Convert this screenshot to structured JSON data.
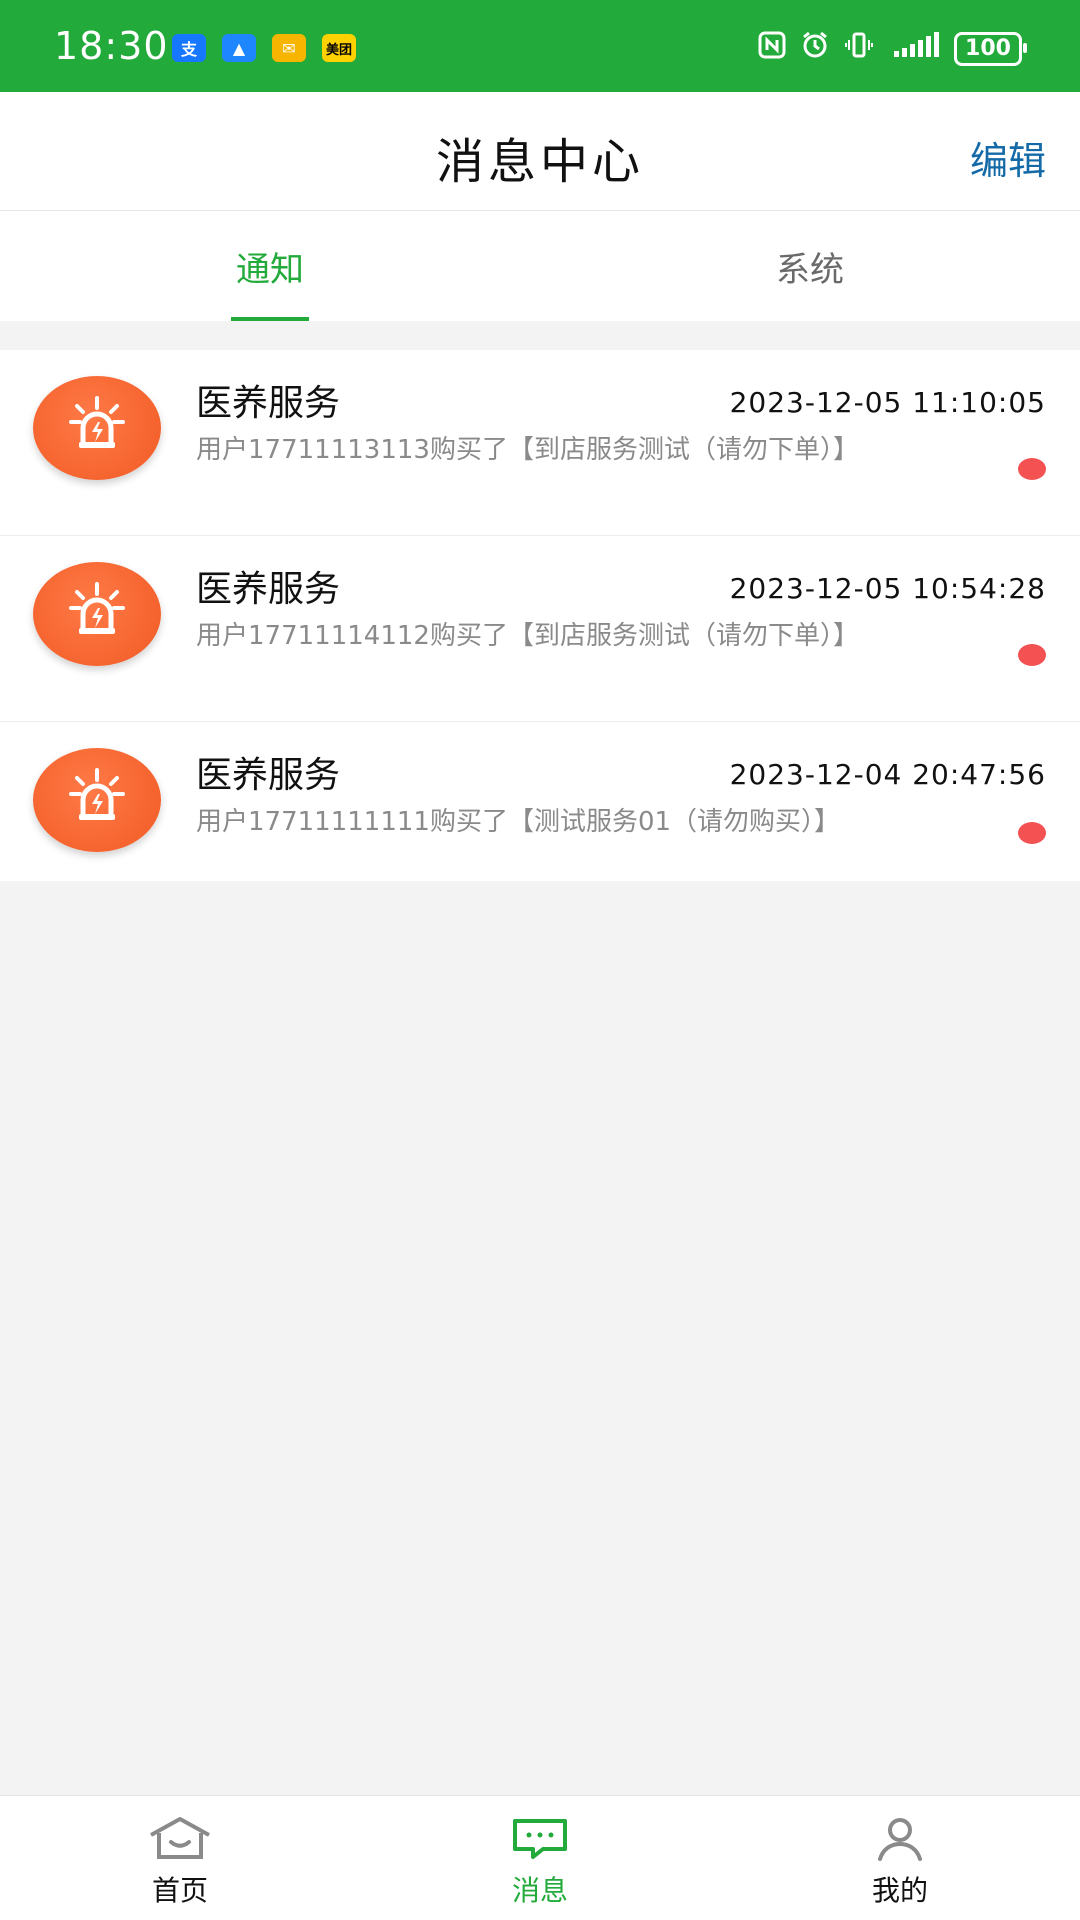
{
  "status_bar": {
    "time": "18:30",
    "apps": [
      {
        "label": "支",
        "name": "alipay-icon",
        "bg": "#1677ff",
        "fg": "#ffffff"
      },
      {
        "label": "▲",
        "name": "nav-app-icon",
        "bg": "#1e86ff",
        "fg": "#ffffff"
      },
      {
        "label": "✉",
        "name": "mail-icon",
        "bg": "#f7b500",
        "fg": "#ffffff"
      },
      {
        "label": "美团",
        "name": "meituan-icon",
        "bg": "#ffd100",
        "fg": "#000000"
      }
    ],
    "battery": "100"
  },
  "header": {
    "title": "消息中心",
    "edit": "编辑"
  },
  "tabs": [
    {
      "label": "通知",
      "active": true
    },
    {
      "label": "系统",
      "active": false
    }
  ],
  "messages": [
    {
      "title": "医养服务",
      "time": "2023-12-05 11:10:05",
      "text": "用户17711113113购买了【到店服务测试（请勿下单）】",
      "unread": true
    },
    {
      "title": "医养服务",
      "time": "2023-12-05 10:54:28",
      "text": "用户17711114112购买了【到店服务测试（请勿下单）】",
      "unread": true
    },
    {
      "title": "医养服务",
      "time": "2023-12-04 20:47:56",
      "text": "用户17711111111购买了【测试服务01（请勿购买）】",
      "unread": true
    }
  ],
  "bottom_nav": [
    {
      "label": "首页",
      "icon": "home-icon",
      "active": false
    },
    {
      "label": "消息",
      "icon": "message-icon",
      "active": true
    },
    {
      "label": "我的",
      "icon": "user-icon",
      "active": false
    }
  ],
  "colors": {
    "brand_green": "#22aa3a",
    "edit_blue": "#136aa7",
    "unread_red": "#f45252",
    "avatar_orange": "#f15a24"
  }
}
